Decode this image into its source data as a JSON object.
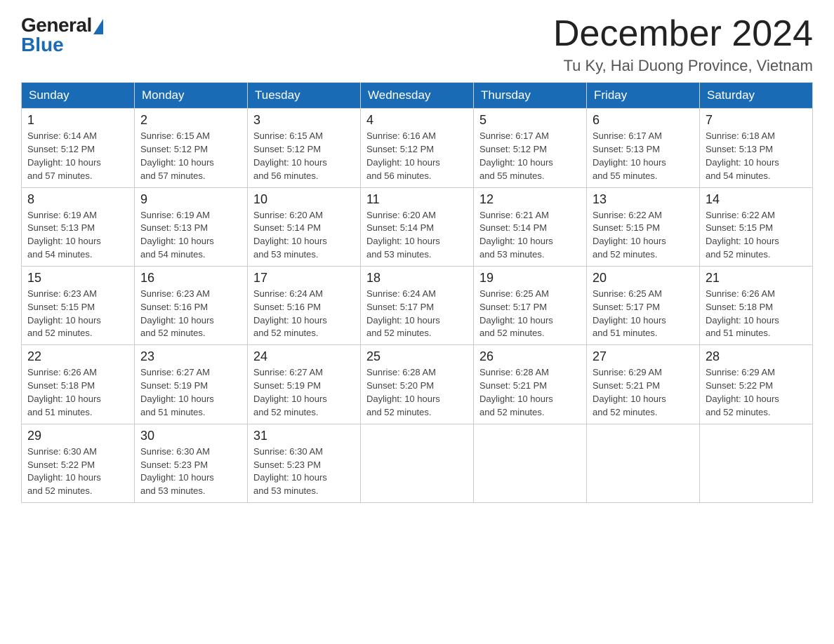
{
  "logo": {
    "general": "General",
    "blue": "Blue"
  },
  "header": {
    "month": "December 2024",
    "location": "Tu Ky, Hai Duong Province, Vietnam"
  },
  "days_of_week": [
    "Sunday",
    "Monday",
    "Tuesday",
    "Wednesday",
    "Thursday",
    "Friday",
    "Saturday"
  ],
  "weeks": [
    [
      {
        "day": "1",
        "sunrise": "6:14 AM",
        "sunset": "5:12 PM",
        "daylight": "10 hours and 57 minutes."
      },
      {
        "day": "2",
        "sunrise": "6:15 AM",
        "sunset": "5:12 PM",
        "daylight": "10 hours and 57 minutes."
      },
      {
        "day": "3",
        "sunrise": "6:15 AM",
        "sunset": "5:12 PM",
        "daylight": "10 hours and 56 minutes."
      },
      {
        "day": "4",
        "sunrise": "6:16 AM",
        "sunset": "5:12 PM",
        "daylight": "10 hours and 56 minutes."
      },
      {
        "day": "5",
        "sunrise": "6:17 AM",
        "sunset": "5:12 PM",
        "daylight": "10 hours and 55 minutes."
      },
      {
        "day": "6",
        "sunrise": "6:17 AM",
        "sunset": "5:13 PM",
        "daylight": "10 hours and 55 minutes."
      },
      {
        "day": "7",
        "sunrise": "6:18 AM",
        "sunset": "5:13 PM",
        "daylight": "10 hours and 54 minutes."
      }
    ],
    [
      {
        "day": "8",
        "sunrise": "6:19 AM",
        "sunset": "5:13 PM",
        "daylight": "10 hours and 54 minutes."
      },
      {
        "day": "9",
        "sunrise": "6:19 AM",
        "sunset": "5:13 PM",
        "daylight": "10 hours and 54 minutes."
      },
      {
        "day": "10",
        "sunrise": "6:20 AM",
        "sunset": "5:14 PM",
        "daylight": "10 hours and 53 minutes."
      },
      {
        "day": "11",
        "sunrise": "6:20 AM",
        "sunset": "5:14 PM",
        "daylight": "10 hours and 53 minutes."
      },
      {
        "day": "12",
        "sunrise": "6:21 AM",
        "sunset": "5:14 PM",
        "daylight": "10 hours and 53 minutes."
      },
      {
        "day": "13",
        "sunrise": "6:22 AM",
        "sunset": "5:15 PM",
        "daylight": "10 hours and 52 minutes."
      },
      {
        "day": "14",
        "sunrise": "6:22 AM",
        "sunset": "5:15 PM",
        "daylight": "10 hours and 52 minutes."
      }
    ],
    [
      {
        "day": "15",
        "sunrise": "6:23 AM",
        "sunset": "5:15 PM",
        "daylight": "10 hours and 52 minutes."
      },
      {
        "day": "16",
        "sunrise": "6:23 AM",
        "sunset": "5:16 PM",
        "daylight": "10 hours and 52 minutes."
      },
      {
        "day": "17",
        "sunrise": "6:24 AM",
        "sunset": "5:16 PM",
        "daylight": "10 hours and 52 minutes."
      },
      {
        "day": "18",
        "sunrise": "6:24 AM",
        "sunset": "5:17 PM",
        "daylight": "10 hours and 52 minutes."
      },
      {
        "day": "19",
        "sunrise": "6:25 AM",
        "sunset": "5:17 PM",
        "daylight": "10 hours and 52 minutes."
      },
      {
        "day": "20",
        "sunrise": "6:25 AM",
        "sunset": "5:17 PM",
        "daylight": "10 hours and 51 minutes."
      },
      {
        "day": "21",
        "sunrise": "6:26 AM",
        "sunset": "5:18 PM",
        "daylight": "10 hours and 51 minutes."
      }
    ],
    [
      {
        "day": "22",
        "sunrise": "6:26 AM",
        "sunset": "5:18 PM",
        "daylight": "10 hours and 51 minutes."
      },
      {
        "day": "23",
        "sunrise": "6:27 AM",
        "sunset": "5:19 PM",
        "daylight": "10 hours and 51 minutes."
      },
      {
        "day": "24",
        "sunrise": "6:27 AM",
        "sunset": "5:19 PM",
        "daylight": "10 hours and 52 minutes."
      },
      {
        "day": "25",
        "sunrise": "6:28 AM",
        "sunset": "5:20 PM",
        "daylight": "10 hours and 52 minutes."
      },
      {
        "day": "26",
        "sunrise": "6:28 AM",
        "sunset": "5:21 PM",
        "daylight": "10 hours and 52 minutes."
      },
      {
        "day": "27",
        "sunrise": "6:29 AM",
        "sunset": "5:21 PM",
        "daylight": "10 hours and 52 minutes."
      },
      {
        "day": "28",
        "sunrise": "6:29 AM",
        "sunset": "5:22 PM",
        "daylight": "10 hours and 52 minutes."
      }
    ],
    [
      {
        "day": "29",
        "sunrise": "6:30 AM",
        "sunset": "5:22 PM",
        "daylight": "10 hours and 52 minutes."
      },
      {
        "day": "30",
        "sunrise": "6:30 AM",
        "sunset": "5:23 PM",
        "daylight": "10 hours and 53 minutes."
      },
      {
        "day": "31",
        "sunrise": "6:30 AM",
        "sunset": "5:23 PM",
        "daylight": "10 hours and 53 minutes."
      },
      null,
      null,
      null,
      null
    ]
  ],
  "labels": {
    "sunrise": "Sunrise:",
    "sunset": "Sunset:",
    "daylight": "Daylight:"
  }
}
